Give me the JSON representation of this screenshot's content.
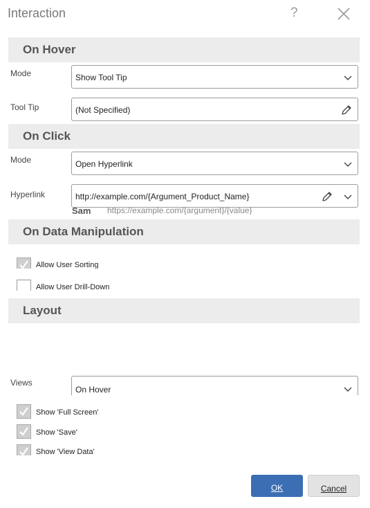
{
  "dialog": {
    "title": "Interaction",
    "help": "?"
  },
  "hover": {
    "header": "On Hover",
    "mode_label": "Mode",
    "mode_value": "Show Tool Tip",
    "tooltip_label": "Tool Tip",
    "tooltip_value": "(Not Specified)"
  },
  "click": {
    "header": "On Click",
    "mode_label": "Mode",
    "mode_value": "Open Hyperlink",
    "hyperlink_label": "Hyperlink",
    "hyperlink_value": "http://example.com/{Argument_Product_Name}",
    "sample_label": "Sam",
    "sample_value": "https://example.com/{argument}/{value}"
  },
  "data_manipulation": {
    "header": "On Data Manipulation",
    "allow_sorting": "Allow User Sorting",
    "allow_drilldown": "Allow User Drill-Down"
  },
  "layout": {
    "header": "Layout",
    "views_label": "Views",
    "views_value": "On Hover",
    "show_full_screen": "Show 'Full Screen'",
    "show_save": "Show 'Save'",
    "show_view_data": "Show 'View Data'"
  },
  "buttons": {
    "ok": "OK",
    "cancel": "Cancel"
  },
  "colors": {
    "accent": "#3c6eb4",
    "section_bg": "#ececec"
  },
  "icons": [
    "close-icon",
    "help-icon",
    "chevron-down-icon",
    "pencil-icon",
    "check-icon"
  ]
}
